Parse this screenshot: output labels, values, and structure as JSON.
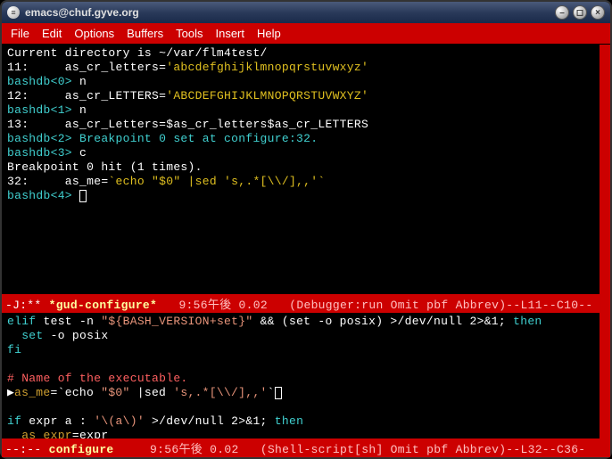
{
  "window": {
    "title": "emacs@chuf.gyve.org",
    "icon_glyph": "≡"
  },
  "menu": {
    "file": "File",
    "edit": "Edit",
    "options": "Options",
    "buffers": "Buffers",
    "tools": "Tools",
    "insert": "Insert",
    "help": "Help"
  },
  "gud": {
    "l0": "Current directory is ~/var/flm4test/",
    "l1a": "11:     as_cr_letters=",
    "l1b": "'abcdefghijklmnopqrstuvwxyz'",
    "p1a": "bashdb<0> ",
    "p1b": "n",
    "l2a": "12:     as_cr_LETTERS=",
    "l2b": "'ABCDEFGHIJKLMNOPQRSTUVWXYZ'",
    "p2a": "bashdb<1> ",
    "p2b": "n",
    "l3": "13:     as_cr_Letters=$as_cr_letters$as_cr_LETTERS",
    "p3": "bashdb<2> Breakpoint 0 set at configure:32.",
    "p4a": "bashdb<3> ",
    "p4b": "c",
    "l4": "Breakpoint 0 hit (1 times).",
    "l5a": "32:     as_me=",
    "l5b": "`echo \"$0\" |sed 's,.*[\\\\/],,'`",
    "p5": "bashdb<4> "
  },
  "mode1": {
    "prefix": "-J:** ",
    "buffer": "*gud-configure*",
    "rest": "   9:56午後 0.02   (Debugger:run Omit pbf Abbrev)--L11--C10--"
  },
  "src": {
    "s1a": "elif",
    "s1b": " test -n ",
    "s1c": "\"${BASH_VERSION+set}\"",
    "s1d": " && (set -o posix) >/dev/null 2>&1; ",
    "s1e": "then",
    "s2a": "  ",
    "s2b": "set",
    "s2c": " -o posix",
    "s3": "fi",
    "s4": "# Name of the executable.",
    "s5a": "as_me",
    "s5b": "=`echo ",
    "s5c": "\"$0\"",
    "s5d": " |sed ",
    "s5e": "'s,.*[\\\\/],,'",
    "s5f": "`",
    "s6a": "if",
    "s6b": " expr a : ",
    "s6c": "'\\(a\\)'",
    "s6d": " >/dev/null 2>&1; ",
    "s6e": "then",
    "s7a": "  ",
    "s7b": "as_expr",
    "s7c": "=expr"
  },
  "mode2": {
    "prefix": "--:-- ",
    "buffer": "configure",
    "rest": "     9:56午後 0.02   (Shell-script[sh] Omit pbf Abbrev)--L32--C36-"
  }
}
